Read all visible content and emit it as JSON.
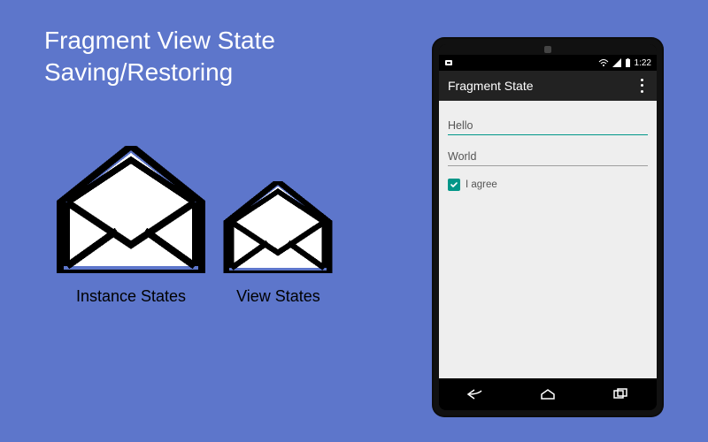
{
  "title_line1": "Fragment View State",
  "title_line2": "Saving/Restoring",
  "envelopes": {
    "instance_label": "Instance States",
    "view_label": "View States"
  },
  "phone": {
    "status": {
      "time": "1:22"
    },
    "actionbar": {
      "title": "Fragment State"
    },
    "fields": {
      "field1": "Hello",
      "field2": "World"
    },
    "checkbox": {
      "checked": true,
      "label": "I agree"
    }
  },
  "colors": {
    "background": "#5d76cb",
    "accent": "#009688",
    "phone_body": "#111111",
    "screen_bg": "#eeeeee"
  }
}
